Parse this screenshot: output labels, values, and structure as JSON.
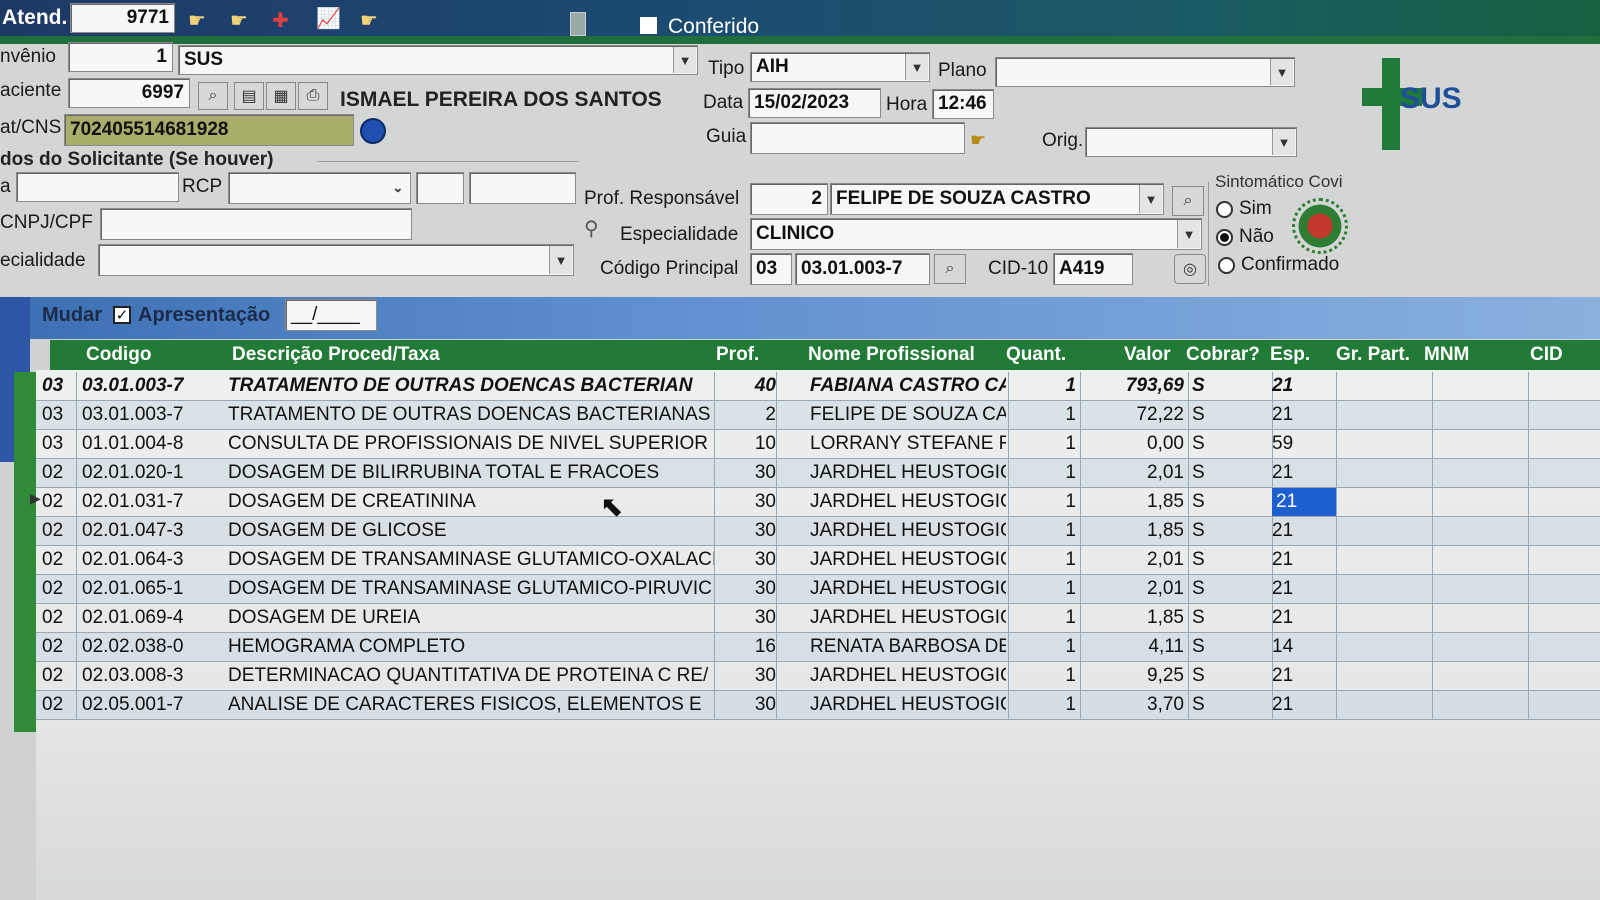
{
  "header": {
    "atend_label": "Atend.",
    "atend_value": "9771",
    "conferido_label": "Conferido"
  },
  "patient": {
    "convenio_label": "nvênio",
    "convenio_code": "1",
    "convenio_name": "SUS",
    "tipo_label": "Tipo",
    "tipo_value": "AIH",
    "plano_label": "Plano",
    "plano_value": "",
    "paciente_label": "aciente",
    "paciente_code": "6997",
    "paciente_name": "ISMAEL PEREIRA DOS SANTOS",
    "data_label": "Data",
    "data_value": "15/02/2023",
    "hora_label": "Hora",
    "hora_value": "12:46",
    "cns_label": "at/CNS",
    "cns_value": "702405514681928",
    "guia_label": "Guia",
    "guia_value": "",
    "orig_label": "Orig.",
    "orig_value": ""
  },
  "solicitante": {
    "group_label": "dos do Solicitante (Se houver)",
    "a_label": "a",
    "rcp_label": "RCP",
    "cnpj_label": "CNPJ/CPF",
    "especialidade_label": "ecialidade"
  },
  "professional": {
    "prof_label": "Prof. Responsável",
    "prof_code": "2",
    "prof_name": "FELIPE DE SOUZA CASTRO",
    "esp_label": "Especialidade",
    "esp_value": "CLINICO",
    "codigo_label": "Código Principal",
    "codigo_group": "03",
    "codigo_value": "03.01.003-7",
    "cid_label": "CID-10",
    "cid_value": "A419"
  },
  "covid": {
    "group_label": "Sintomático Covi",
    "options": [
      "Sim",
      "Não",
      "Confirmado"
    ],
    "selected": "Não"
  },
  "toolbar2": {
    "mudar_label": "Mudar",
    "apresentacao_label": "Apresentação",
    "apresentacao_value": "__/____"
  },
  "grid": {
    "columns": [
      "Codigo",
      "Descrição Proced/Taxa",
      "Prof.",
      "Nome Profissional",
      "Quant.",
      "Valor",
      "Cobrar?",
      "Esp.",
      "Gr. Part.",
      "MNM",
      "CID"
    ],
    "rows": [
      {
        "grp": "03",
        "code": "03.01.003-7",
        "desc": "TRATAMENTO DE OUTRAS DOENCAS BACTERIAN",
        "prof": "40",
        "nome": "FABIANA CASTRO CA",
        "quant": "1",
        "valor": "793,69",
        "cobrar": "S",
        "esp": "21"
      },
      {
        "grp": "03",
        "code": "03.01.003-7",
        "desc": "TRATAMENTO DE OUTRAS DOENCAS BACTERIANAS",
        "prof": "2",
        "nome": "FELIPE DE SOUZA CAS",
        "quant": "1",
        "valor": "72,22",
        "cobrar": "S",
        "esp": "21"
      },
      {
        "grp": "03",
        "code": "01.01.004-8",
        "desc": "CONSULTA DE PROFISSIONAIS DE NIVEL SUPERIOR",
        "prof": "10",
        "nome": "LORRANY STEFANE R",
        "quant": "1",
        "valor": "0,00",
        "cobrar": "S",
        "esp": "59"
      },
      {
        "grp": "02",
        "code": "02.01.020-1",
        "desc": "DOSAGEM DE BILIRRUBINA TOTAL E FRACOES",
        "prof": "30",
        "nome": "JARDHEL HEUSTOGIC",
        "quant": "1",
        "valor": "2,01",
        "cobrar": "S",
        "esp": "21"
      },
      {
        "grp": "02",
        "code": "02.01.031-7",
        "desc": "DOSAGEM DE CREATININA",
        "prof": "30",
        "nome": "JARDHEL HEUSTOGIC",
        "quant": "1",
        "valor": "1,85",
        "cobrar": "S",
        "esp": "21"
      },
      {
        "grp": "02",
        "code": "02.01.047-3",
        "desc": "DOSAGEM DE GLICOSE",
        "prof": "30",
        "nome": "JARDHEL HEUSTOGIC",
        "quant": "1",
        "valor": "1,85",
        "cobrar": "S",
        "esp": "21"
      },
      {
        "grp": "02",
        "code": "02.01.064-3",
        "desc": "DOSAGEM DE TRANSAMINASE GLUTAMICO-OXALACI",
        "prof": "30",
        "nome": "JARDHEL HEUSTOGIC",
        "quant": "1",
        "valor": "2,01",
        "cobrar": "S",
        "esp": "21"
      },
      {
        "grp": "02",
        "code": "02.01.065-1",
        "desc": "DOSAGEM DE TRANSAMINASE GLUTAMICO-PIRUVIC",
        "prof": "30",
        "nome": "JARDHEL HEUSTOGIC",
        "quant": "1",
        "valor": "2,01",
        "cobrar": "S",
        "esp": "21"
      },
      {
        "grp": "02",
        "code": "02.01.069-4",
        "desc": "DOSAGEM DE UREIA",
        "prof": "30",
        "nome": "JARDHEL HEUSTOGIC",
        "quant": "1",
        "valor": "1,85",
        "cobrar": "S",
        "esp": "21"
      },
      {
        "grp": "02",
        "code": "02.02.038-0",
        "desc": "HEMOGRAMA COMPLETO",
        "prof": "16",
        "nome": "RENATA BARBOSA DE",
        "quant": "1",
        "valor": "4,11",
        "cobrar": "S",
        "esp": "14"
      },
      {
        "grp": "02",
        "code": "02.03.008-3",
        "desc": "DETERMINACAO QUANTITATIVA DE PROTEINA C RE/",
        "prof": "30",
        "nome": "JARDHEL HEUSTOGIC",
        "quant": "1",
        "valor": "9,25",
        "cobrar": "S",
        "esp": "21"
      },
      {
        "grp": "02",
        "code": "02.05.001-7",
        "desc": "ANALISE DE CARACTERES FISICOS, ELEMENTOS E",
        "prof": "30",
        "nome": "JARDHEL HEUSTOGIC",
        "quant": "1",
        "valor": "3,70",
        "cobrar": "S",
        "esp": "21"
      }
    ]
  },
  "colors": {
    "grid_header": "#217a35",
    "selection": "#1d5fd0",
    "top_bar": "#1e3866"
  }
}
